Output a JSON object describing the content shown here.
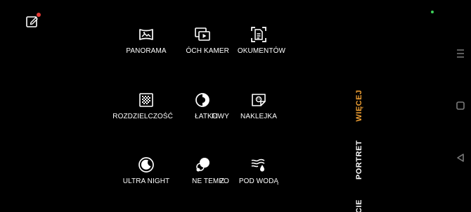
{
  "colors": {
    "background": "#000000",
    "text": "#ffffff",
    "accent": "#f0a033",
    "notification_dot": "#e53935",
    "status_dot": "#3ecf5a",
    "nav": "#7a7a7a"
  },
  "modes": [
    {
      "label": "PANORAMA",
      "icon": "panorama-icon"
    },
    {
      "label": "ÓCH KAMER",
      "icon": "dual-camera-icon"
    },
    {
      "label": "OKUMENTÓW",
      "icon": "document-scan-icon"
    },
    {
      "label": "ROZDZIELCZOŚĆ",
      "icon": "high-resolution-icon"
    },
    {
      "label": "ŁATKOWY",
      "icon": "filter-icon"
    },
    {
      "label": "FI",
      "icon": ""
    },
    {
      "label": "NAKLEJKA",
      "icon": "sticker-icon"
    },
    {
      "label": "ULTRA NIGHT",
      "icon": "ultra-night-icon"
    },
    {
      "label": "NE TEMPO",
      "icon": "slow-motion-icon"
    },
    {
      "label": "Z",
      "icon": ""
    },
    {
      "label": "POD WODĄ",
      "icon": "underwater-icon"
    }
  ],
  "mode_tabs": [
    {
      "label": "WIĘCEJ",
      "active": true
    },
    {
      "label": "PORTRET",
      "active": false
    },
    {
      "label": "CIE",
      "active": false
    }
  ],
  "nav_buttons": [
    "menu-icon",
    "home-square-icon",
    "back-triangle-icon"
  ]
}
